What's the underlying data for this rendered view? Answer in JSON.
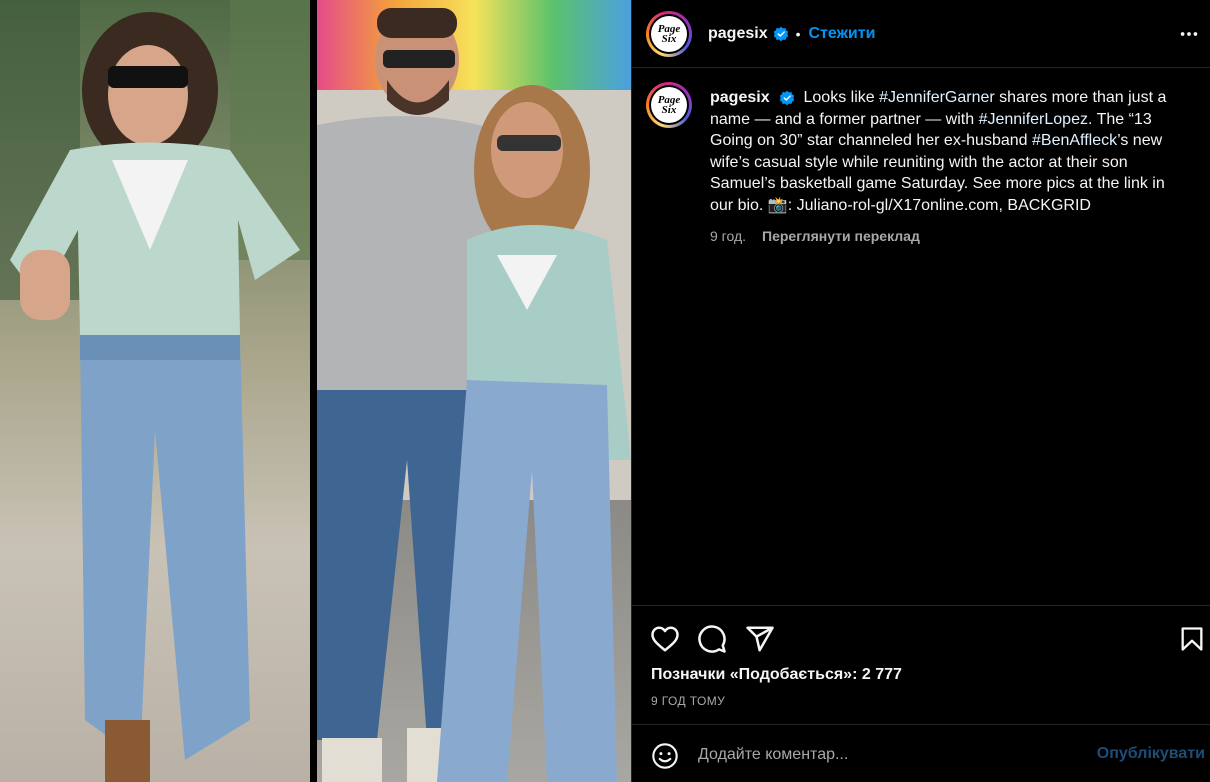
{
  "header": {
    "username": "pagesix",
    "separator": "•",
    "follow_label": "Стежити",
    "avatar_logo_line1": "Page",
    "avatar_logo_line2": "Six"
  },
  "caption": {
    "username": "pagesix",
    "segments": [
      {
        "text": "Looks like ",
        "type": "text"
      },
      {
        "text": "#JenniferGarner",
        "type": "hashtag"
      },
      {
        "text": " shares more than just a name — and a former partner — with ",
        "type": "text"
      },
      {
        "text": "#JenniferLopez",
        "type": "hashtag"
      },
      {
        "text": ". The “13 Going on 30” star channeled her ex-husband ",
        "type": "text"
      },
      {
        "text": "#BenAffleck",
        "type": "hashtag"
      },
      {
        "text": "’s new wife’s casual style while reuniting with the actor at their son Samuel’s basketball game Saturday. See more pics at the link in our bio. 📸: Juliano-rol-gl/X17online.com, BACKGRID",
        "type": "text"
      }
    ],
    "time_ago": "9 год.",
    "translate_label": "Переглянути переклад"
  },
  "engagement": {
    "likes_text": "Позначки «Подобається»: 2 777",
    "posted_time": "9 ГОД ТОМУ"
  },
  "comment": {
    "placeholder": "Додайте коментар...",
    "post_label": "Опублікувати"
  },
  "colors": {
    "accent": "#0095f6",
    "hashtag": "#e0f1ff",
    "muted": "#a8a8a8",
    "post_disabled": "#1d4d7a",
    "divider": "#262626"
  },
  "icons": [
    "heart-icon",
    "comment-icon",
    "share-icon",
    "bookmark-icon",
    "more-icon",
    "emoji-icon",
    "verified-badge-icon"
  ]
}
